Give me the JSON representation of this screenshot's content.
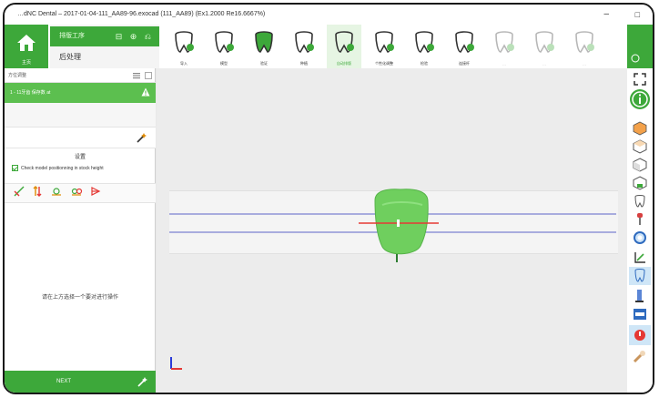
{
  "window": {
    "title": "…dNC Dental – 2017-01-04-111_AA89-96.exocad (111_AA89) (Ex1.2000 Re16.6667%)",
    "minimize_glyph": "–",
    "maximize_glyph": "□"
  },
  "home": {
    "label": "主页",
    "icon": "home-icon"
  },
  "workflow": {
    "stage": "排版工序",
    "stage_icons": "⊟ ⊕ ⎌",
    "sub": "后处理"
  },
  "toolbar": {
    "tools": [
      {
        "label": "导入",
        "icon": "tooth-add-icon",
        "state": "normal"
      },
      {
        "label": "模型",
        "icon": "tooth-model-icon",
        "state": "normal"
      },
      {
        "label": "验证",
        "icon": "tooth-check-icon",
        "state": "normal"
      },
      {
        "label": "种植",
        "icon": "tooth-implant-icon",
        "state": "normal"
      },
      {
        "label": "自动排版",
        "icon": "tooth-arrange-icon",
        "state": "active"
      },
      {
        "label": "个性化调整",
        "icon": "tooth-adjust-icon",
        "state": "normal"
      },
      {
        "label": "检验",
        "icon": "tooth-inspect-icon",
        "state": "normal"
      },
      {
        "label": "连接杆",
        "icon": "tooth-connect-icon",
        "state": "normal"
      },
      {
        "label": "…",
        "icon": "tooth-disabled-1-icon",
        "state": "disabled"
      },
      {
        "label": "…",
        "icon": "tooth-disabled-2-icon",
        "state": "disabled"
      },
      {
        "label": "…",
        "icon": "tooth-disabled-3-icon",
        "state": "disabled"
      }
    ]
  },
  "left_panel": {
    "header": "方位调整",
    "selected_item": "1 - 11牙齿 保存数 at",
    "section_title": "设置",
    "checkbox_label": "Check model positionning in stock height",
    "checkbox_checked": true,
    "hint": "请在上方选择一个要对进行操作",
    "next_label": "NEXT"
  },
  "colors": {
    "accent": "#3da83a",
    "accent_light": "#5cbf4f",
    "viewport_bg": "#ececec",
    "guide_line": "#5b63c8",
    "red_axis": "#e53935"
  }
}
